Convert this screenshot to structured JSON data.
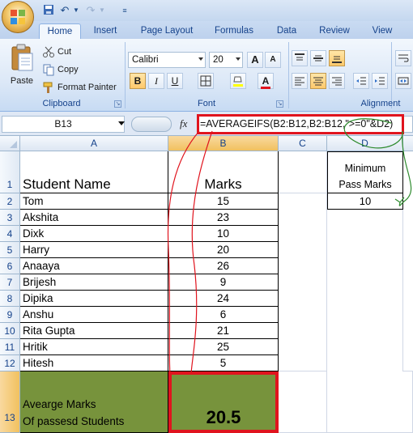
{
  "quick_access": {
    "undo_label": "↶",
    "redo_label": "↷"
  },
  "tabs": [
    "Home",
    "Insert",
    "Page Layout",
    "Formulas",
    "Data",
    "Review",
    "View"
  ],
  "clipboard": {
    "paste": "Paste",
    "cut": "Cut",
    "copy": "Copy",
    "format_painter": "Format Painter",
    "group_label": "Clipboard"
  },
  "font": {
    "family": "Calibri",
    "size": "20",
    "grow": "A",
    "shrink": "A",
    "bold": "B",
    "italic": "I",
    "underline": "U",
    "font_color": "A",
    "group_label": "Font"
  },
  "alignment": {
    "group_label": "Alignment"
  },
  "formula_bar": {
    "name_box": "B13",
    "fx": "fx",
    "formula": "=AVERAGEIFS(B2:B12,B2:B12,\">=0\"&D2)"
  },
  "columns": [
    "A",
    "B",
    "C",
    "D"
  ],
  "rows": [
    "1",
    "2",
    "3",
    "4",
    "5",
    "6",
    "7",
    "8",
    "9",
    "10",
    "11",
    "12",
    "13"
  ],
  "header": {
    "name": "Student Name",
    "marks": "Marks",
    "min_line1": "Minimum",
    "min_line2": "Pass Marks",
    "min_value": "10"
  },
  "students": [
    {
      "name": "Tom",
      "marks": "15"
    },
    {
      "name": "Akshita",
      "marks": "23"
    },
    {
      "name": "Dixk",
      "marks": "10"
    },
    {
      "name": "Harry",
      "marks": "20"
    },
    {
      "name": "Anaaya",
      "marks": "26"
    },
    {
      "name": "Brijesh",
      "marks": "9"
    },
    {
      "name": "Dipika",
      "marks": "24"
    },
    {
      "name": "Anshu",
      "marks": "6"
    },
    {
      "name": "Rita Gupta",
      "marks": "21"
    },
    {
      "name": "Hritik",
      "marks": "25"
    },
    {
      "name": "Hitesh",
      "marks": "5"
    }
  ],
  "result": {
    "label_line1": "Avearge Marks",
    "label_line2": "Of passesd Students",
    "value": "20.5"
  },
  "colors": {
    "accent_red": "#e0141e",
    "olive": "#77933c",
    "selection": "#f1c15f"
  }
}
